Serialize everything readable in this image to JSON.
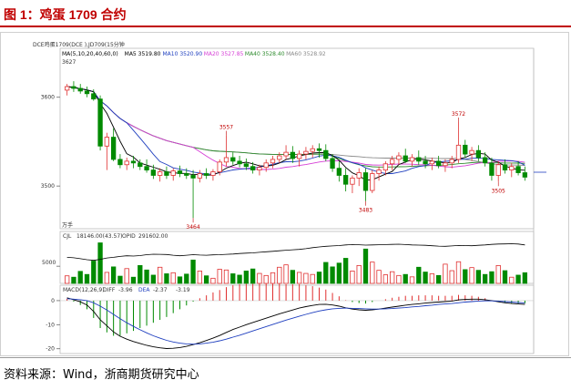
{
  "figure_title": "图 1：鸡蛋 1709 合约",
  "source_text": "资料来源：Wind，浙商期货研究中心",
  "chart_data": {
    "type": "candlestick",
    "header": "DCE鸡蛋1709(DCE ),JD709(15分钟",
    "top_left_value": "3627",
    "unit_label": "万手",
    "price_axis": {
      "ticks": [
        3600,
        3500
      ],
      "ylim": [
        3455,
        3650
      ]
    },
    "ma_legend": [
      {
        "label": "MA(5,10,20,40,60,0)",
        "color": "#000000"
      },
      {
        "label": "MA5 3519.80",
        "color": "#000000"
      },
      {
        "label": "MA10 3520.90",
        "color": "#1f3fbf"
      },
      {
        "label": "MA20 3527.85",
        "color": "#d63fd6"
      },
      {
        "label": "MA40 3528.40",
        "color": "#2e8b2e"
      },
      {
        "label": "MA60 3528.92",
        "color": "#8a8a8a"
      }
    ],
    "annotations": [
      {
        "label": "3557",
        "bar": 24,
        "value": 3557,
        "pos": "above"
      },
      {
        "label": "3464",
        "bar": 19,
        "value": 3464,
        "pos": "below"
      },
      {
        "label": "3572",
        "bar": 59,
        "value": 3572,
        "pos": "above"
      },
      {
        "label": "3483",
        "bar": 45,
        "value": 3483,
        "pos": "below"
      },
      {
        "label": "3505",
        "bar": 65,
        "value": 3505,
        "pos": "below"
      }
    ],
    "candles": [
      [
        3608,
        3615,
        3602,
        3612
      ],
      [
        3612,
        3618,
        3606,
        3610
      ],
      [
        3610,
        3615,
        3604,
        3607
      ],
      [
        3607,
        3612,
        3600,
        3604
      ],
      [
        3604,
        3609,
        3596,
        3598
      ],
      [
        3598,
        3602,
        3540,
        3545
      ],
      [
        3545,
        3560,
        3518,
        3555
      ],
      [
        3555,
        3565,
        3528,
        3530
      ],
      [
        3530,
        3536,
        3520,
        3524
      ],
      [
        3524,
        3532,
        3518,
        3528
      ],
      [
        3528,
        3534,
        3520,
        3526
      ],
      [
        3526,
        3530,
        3518,
        3522
      ],
      [
        3522,
        3530,
        3515,
        3518
      ],
      [
        3518,
        3524,
        3508,
        3512
      ],
      [
        3512,
        3520,
        3505,
        3516
      ],
      [
        3516,
        3522,
        3508,
        3512
      ],
      [
        3512,
        3520,
        3506,
        3517
      ],
      [
        3517,
        3523,
        3510,
        3514
      ],
      [
        3514,
        3520,
        3508,
        3512
      ],
      [
        3512,
        3518,
        3464,
        3509
      ],
      [
        3509,
        3518,
        3504,
        3514
      ],
      [
        3514,
        3520,
        3508,
        3512
      ],
      [
        3512,
        3519,
        3506,
        3516
      ],
      [
        3516,
        3530,
        3512,
        3527
      ],
      [
        3527,
        3557,
        3522,
        3532
      ],
      [
        3532,
        3538,
        3524,
        3528
      ],
      [
        3528,
        3534,
        3521,
        3525
      ],
      [
        3525,
        3531,
        3518,
        3522
      ],
      [
        3522,
        3527,
        3514,
        3518
      ],
      [
        3518,
        3524,
        3512,
        3521
      ],
      [
        3521,
        3530,
        3516,
        3526
      ],
      [
        3526,
        3534,
        3520,
        3530
      ],
      [
        3530,
        3538,
        3526,
        3534
      ],
      [
        3534,
        3546,
        3530,
        3538
      ],
      [
        3538,
        3545,
        3526,
        3531
      ],
      [
        3531,
        3540,
        3522,
        3536
      ],
      [
        3536,
        3544,
        3530,
        3539
      ],
      [
        3539,
        3546,
        3532,
        3542
      ],
      [
        3542,
        3548,
        3532,
        3540
      ],
      [
        3540,
        3547,
        3528,
        3531
      ],
      [
        3531,
        3536,
        3516,
        3520
      ],
      [
        3520,
        3528,
        3505,
        3512
      ],
      [
        3512,
        3520,
        3494,
        3502
      ],
      [
        3502,
        3512,
        3492,
        3509
      ],
      [
        3509,
        3520,
        3500,
        3515
      ],
      [
        3515,
        3520,
        3483,
        3495
      ],
      [
        3495,
        3518,
        3492,
        3514
      ],
      [
        3514,
        3522,
        3506,
        3518
      ],
      [
        3518,
        3528,
        3512,
        3525
      ],
      [
        3525,
        3534,
        3518,
        3530
      ],
      [
        3530,
        3538,
        3524,
        3534
      ],
      [
        3534,
        3542,
        3526,
        3528
      ],
      [
        3528,
        3536,
        3522,
        3532
      ],
      [
        3532,
        3540,
        3524,
        3528
      ],
      [
        3528,
        3534,
        3520,
        3525
      ],
      [
        3525,
        3532,
        3518,
        3528
      ],
      [
        3528,
        3534,
        3520,
        3523
      ],
      [
        3523,
        3530,
        3516,
        3526
      ],
      [
        3526,
        3534,
        3520,
        3530
      ],
      [
        3530,
        3572,
        3526,
        3546
      ],
      [
        3546,
        3552,
        3532,
        3536
      ],
      [
        3536,
        3544,
        3528,
        3540
      ],
      [
        3540,
        3546,
        3528,
        3532
      ],
      [
        3532,
        3538,
        3522,
        3526
      ],
      [
        3526,
        3532,
        3506,
        3512
      ],
      [
        3512,
        3528,
        3505,
        3524
      ],
      [
        3524,
        3530,
        3514,
        3518
      ],
      [
        3518,
        3526,
        3510,
        3522
      ],
      [
        3522,
        3528,
        3512,
        3515
      ],
      [
        3515,
        3522,
        3506,
        3510
      ]
    ],
    "indicators": {
      "volume_title": "CJL",
      "volume_value": "18146.00(43.57)",
      "oi_title": "OPID",
      "oi_value": "291602.00",
      "volume_axis_tick": "5000",
      "volume_ylim": [
        0,
        13000
      ],
      "volume": [
        2200,
        1800,
        3500,
        2600,
        6500,
        11800,
        3200,
        4800,
        2100,
        4300,
        1800,
        5200,
        3900,
        2400,
        4700,
        2800,
        3100,
        1900,
        2700,
        6800,
        3600,
        2200,
        1500,
        4100,
        3900,
        2800,
        2400,
        3600,
        4200,
        2900,
        2300,
        3100,
        4700,
        5400,
        3800,
        3200,
        2900,
        2600,
        3300,
        6100,
        4800,
        5900,
        7300,
        3600,
        5200,
        10000,
        6200,
        3800,
        2500,
        3400,
        2300,
        2600,
        1900,
        4700,
        3300,
        2800,
        2300,
        5600,
        3700,
        6300,
        4000,
        4600,
        3800,
        2600,
        3400,
        5200,
        3700,
        1800,
        2400,
        3100
      ],
      "oi_ylim": [
        0,
        13000
      ],
      "open_interest": [
        7600,
        7450,
        7200,
        6900,
        6700,
        7000,
        7400,
        7600,
        7850,
        8050,
        7950,
        8100,
        8350,
        8500,
        8450,
        8400,
        8200,
        8050,
        8200,
        8350,
        8250,
        8200,
        8300,
        8350,
        8450,
        8550,
        8700,
        8800,
        8900,
        9050,
        9200,
        9350,
        9500,
        9650,
        9800,
        9900,
        10100,
        10400,
        10600,
        10800,
        10900,
        11000,
        11200,
        11300,
        11250,
        11150,
        11200,
        11250,
        11300,
        11350,
        11400,
        11300,
        11200,
        11150,
        11100,
        10950,
        10850,
        10800,
        10900,
        11050,
        11000,
        10950,
        11100,
        11200,
        11350,
        11450,
        11500,
        11550,
        11450,
        11200
      ],
      "macd_title": "MACD(12,26,9)",
      "diff_label": "DIFF",
      "diff_value": "-3.96",
      "dea_label": "DEA",
      "dea_value": "-2.37",
      "macd_value": "-3.19",
      "macd_ylim": [
        -22,
        3
      ],
      "macd_ticks": [
        0,
        -10,
        -20
      ],
      "diff": [
        1.2,
        0.4,
        -0.5,
        -1.8,
        -4.5,
        -8.0,
        -10.5,
        -13.0,
        -14.8,
        -16.0,
        -17.0,
        -17.8,
        -18.6,
        -19.2,
        -19.6,
        -19.9,
        -19.8,
        -19.5,
        -19.0,
        -18.3,
        -17.5,
        -16.6,
        -15.6,
        -14.5,
        -13.2,
        -12.0,
        -11.0,
        -10.0,
        -9.1,
        -8.2,
        -7.3,
        -6.4,
        -5.5,
        -4.7,
        -3.9,
        -3.1,
        -2.5,
        -2.0,
        -1.6,
        -1.5,
        -1.8,
        -2.3,
        -3.0,
        -3.5,
        -3.8,
        -4.0,
        -3.8,
        -3.5,
        -3.1,
        -2.7,
        -2.3,
        -1.9,
        -1.6,
        -1.3,
        -1.0,
        -0.8,
        -0.6,
        -0.4,
        -0.2,
        0.3,
        0.5,
        0.6,
        0.6,
        0.4,
        0.0,
        -0.5,
        -0.9,
        -1.2,
        -1.4,
        -1.6
      ],
      "dea": [
        0.8,
        0.6,
        0.4,
        0.0,
        -0.9,
        -2.3,
        -3.9,
        -5.7,
        -7.5,
        -9.2,
        -10.7,
        -12.1,
        -13.4,
        -14.6,
        -15.6,
        -16.5,
        -17.2,
        -17.7,
        -18.0,
        -18.1,
        -18.0,
        -17.7,
        -17.3,
        -16.7,
        -16.0,
        -15.2,
        -14.4,
        -13.5,
        -12.6,
        -11.7,
        -10.8,
        -9.9,
        -9.0,
        -8.1,
        -7.3,
        -6.5,
        -5.7,
        -5.0,
        -4.3,
        -3.8,
        -3.4,
        -3.2,
        -3.1,
        -3.2,
        -3.3,
        -3.4,
        -3.5,
        -3.5,
        -3.4,
        -3.3,
        -3.1,
        -2.9,
        -2.6,
        -2.4,
        -2.1,
        -1.9,
        -1.6,
        -1.4,
        -1.2,
        -0.9,
        -0.6,
        -0.4,
        -0.2,
        -0.1,
        -0.1,
        -0.2,
        -0.4,
        -0.6,
        -0.8,
        -1.0
      ]
    },
    "colors": {
      "up": "#e03030",
      "down": "#008a00",
      "ma5": "#000000",
      "ma10": "#1f3fbf",
      "ma20": "#d63fd6",
      "ma40": "#2e8b2e",
      "ma60": "#8a8a8a",
      "oi": "#000000",
      "diff": "#000000",
      "dea": "#1f3fbf",
      "macd_pos": "#e03030",
      "macd_neg": "#008a00",
      "annotation": "#c00000"
    }
  }
}
